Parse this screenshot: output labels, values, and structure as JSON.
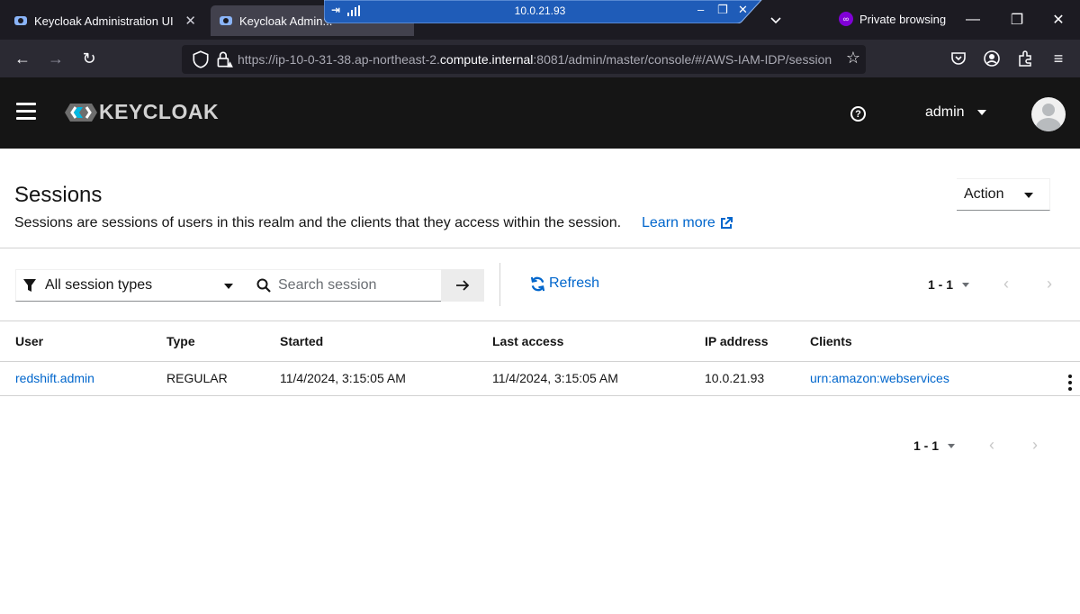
{
  "browser": {
    "tabs": [
      {
        "label": "Keycloak Administration UI",
        "close": "✕"
      },
      {
        "label": "Keycloak Admin..."
      }
    ],
    "private_label": "Private browsing",
    "url_prefix": "https://ip-10-0-31-38.ap-northeast-2.",
    "url_domain": "compute.internal",
    "url_suffix": ":8081/admin/master/console/#/AWS-IAM-IDP/sessions",
    "remote_ip": "10.0.21.93"
  },
  "masthead": {
    "logo_text": "KEYCLOAK",
    "help": "?",
    "user": "admin"
  },
  "page": {
    "title": "Sessions",
    "description": "Sessions are sessions of users in this realm and the clients that they access within the session.",
    "learn_more": "Learn more",
    "action_label": "Action"
  },
  "toolbar": {
    "filter_label": "All session types",
    "search_placeholder": "Search session",
    "refresh_label": "Refresh",
    "pagination_top": "1 - 1",
    "pagination_bottom": "1 - 1"
  },
  "table": {
    "headers": [
      "User",
      "Type",
      "Started",
      "Last access",
      "IP address",
      "Clients"
    ],
    "rows": [
      {
        "user": "redshift.admin",
        "type": "REGULAR",
        "started": "11/4/2024, 3:15:05 AM",
        "last_access": "11/4/2024, 3:15:05 AM",
        "ip": "10.0.21.93",
        "clients": "urn:amazon:webservices"
      }
    ]
  },
  "colors": {
    "link": "#0066cc",
    "masthead_bg": "#151515",
    "browser_bg": "#1c1b22",
    "remote_bar": "#1f5cb8"
  }
}
